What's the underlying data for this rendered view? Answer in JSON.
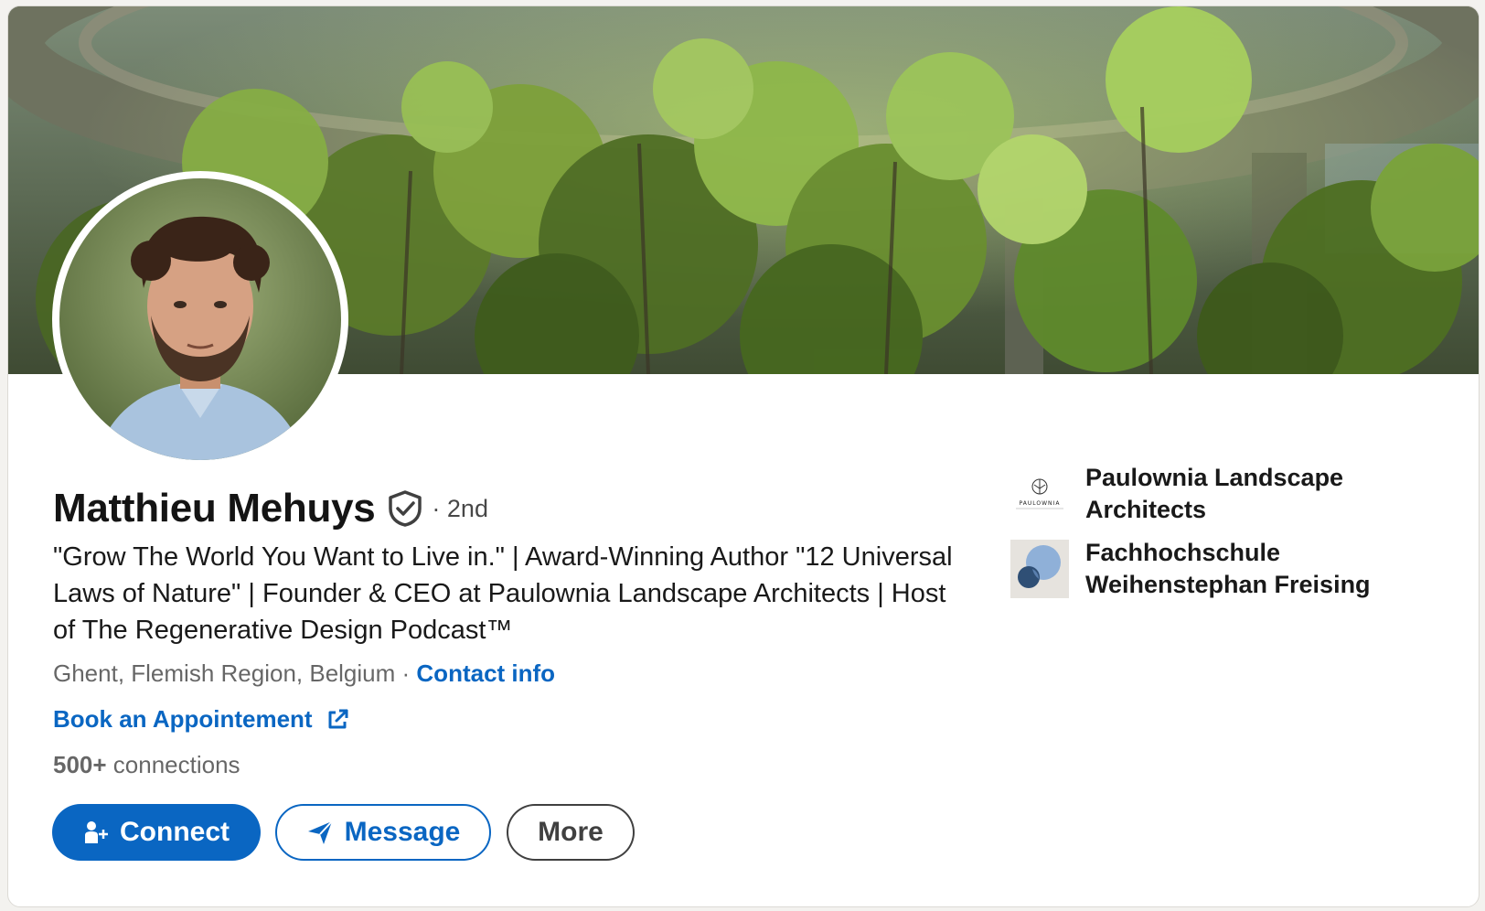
{
  "profile": {
    "name": "Matthieu Mehuys",
    "degree": "· 2nd",
    "headline": "\"Grow The World You Want to Live in.\" | Award-Winning Author \"12 Universal Laws of Nature\" | Founder & CEO at Paulownia Landscape Architects | Host of The Regenerative Design Podcast™",
    "location": "Ghent, Flemish Region, Belgium",
    "separator": " · ",
    "contact_info": "Contact info",
    "book_link": "Book an Appointement",
    "connections_count": "500+",
    "connections_label": " connections"
  },
  "actions": {
    "connect": "Connect",
    "message": "Message",
    "more": "More"
  },
  "organizations": [
    {
      "name": "Paulownia Landscape Architects",
      "logo_text": "PAULOWNIA"
    },
    {
      "name": "Fachhochschule Weihenstephan Freising"
    }
  ],
  "colors": {
    "accent": "#0a66c2",
    "card": "#ffffff",
    "page": "#f3f2ef"
  },
  "icons": {
    "verified": "verified-shield-icon",
    "external": "external-link-icon",
    "connect": "add-person-icon",
    "message": "paper-plane-icon"
  }
}
